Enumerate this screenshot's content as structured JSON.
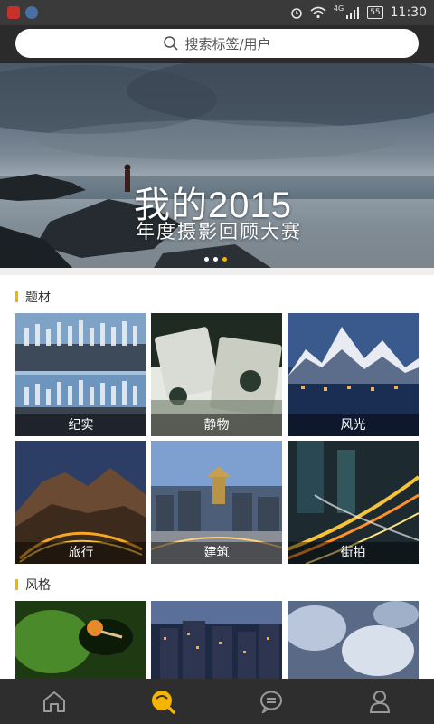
{
  "status_bar": {
    "time": "11:30",
    "battery": "55",
    "network": "4G"
  },
  "search": {
    "placeholder": "搜索标签/用户"
  },
  "banner": {
    "title": "我的2015",
    "subtitle": "年度摄影回顾大赛",
    "dot_count": 3,
    "active_dot": 3
  },
  "sections": [
    {
      "title": "题材",
      "tiles": [
        "纪实",
        "静物",
        "风光",
        "旅行",
        "建筑",
        "街拍"
      ]
    },
    {
      "title": "风格",
      "tiles": [
        "",
        "",
        ""
      ]
    }
  ],
  "colors": {
    "accent": "#f5b400",
    "status_bar": "#3a3a3a",
    "nav_bar": "#2e2e2e"
  },
  "nav": [
    "home-icon",
    "discover-icon",
    "message-icon",
    "profile-icon"
  ]
}
